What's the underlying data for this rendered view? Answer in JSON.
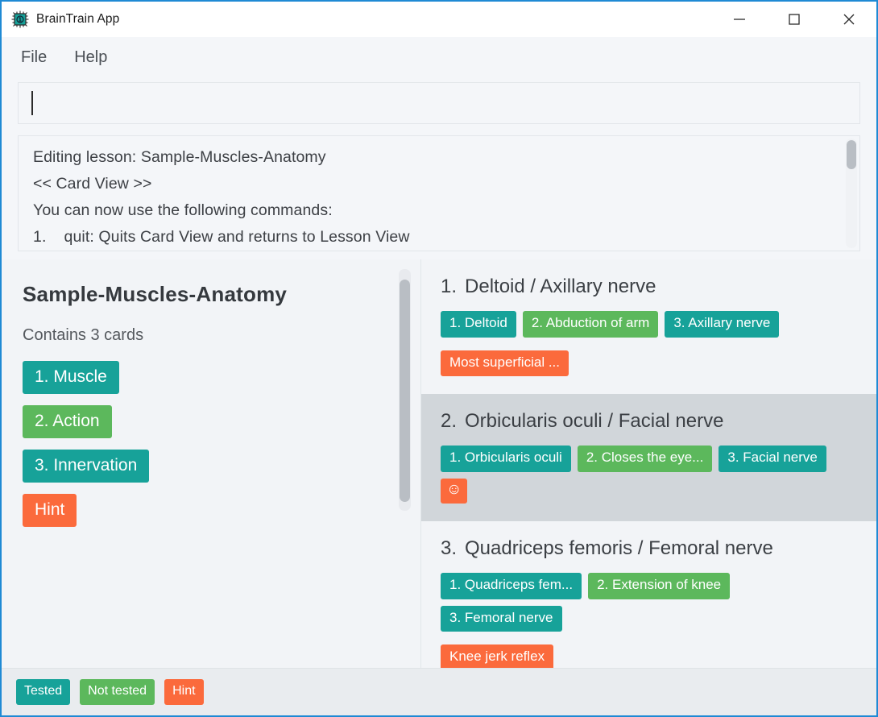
{
  "window": {
    "title": "BrainTrain App",
    "app_icon": "microchip-icon",
    "minimize_label": "Minimize",
    "maximize_label": "Maximize",
    "close_label": "Close"
  },
  "menubar": {
    "items": [
      {
        "label": "File"
      },
      {
        "label": "Help"
      }
    ]
  },
  "command_input": {
    "value": "",
    "placeholder": ""
  },
  "console": {
    "lines": [
      "Editing lesson: Sample-Muscles-Anatomy",
      "<< Card View >>",
      "You can now use the following commands:",
      "1.    quit: Quits Card View and returns to Lesson View"
    ]
  },
  "lesson_panel": {
    "title": "Sample-Muscles-Anatomy",
    "card_count_text": "Contains 3 cards",
    "fields": [
      {
        "label": "1. Muscle",
        "state": "tested"
      },
      {
        "label": "2. Action",
        "state": "not-tested"
      },
      {
        "label": "3. Innervation",
        "state": "tested"
      },
      {
        "label": "Hint",
        "state": "hint"
      }
    ]
  },
  "cards": [
    {
      "index": "1.",
      "title": "Deltoid / Axillary nerve",
      "selected": false,
      "chips": [
        {
          "label": "1. Deltoid",
          "state": "tested",
          "icon": false
        },
        {
          "label": "2. Abduction of arm",
          "state": "not-tested",
          "icon": false
        },
        {
          "label": "3. Axillary nerve",
          "state": "tested",
          "icon": false
        },
        {
          "label": "Most superficial ...",
          "state": "hint",
          "icon": false
        }
      ]
    },
    {
      "index": "2.",
      "title": "Orbicularis oculi / Facial nerve",
      "selected": true,
      "chips": [
        {
          "label": "1. Orbicularis oculi",
          "state": "tested",
          "icon": false
        },
        {
          "label": "2. Closes the eye...",
          "state": "not-tested",
          "icon": false
        },
        {
          "label": "3. Facial nerve",
          "state": "tested",
          "icon": false
        },
        {
          "label": "☺",
          "state": "hint",
          "icon": true,
          "icon_name": "smiley-face-icon"
        }
      ]
    },
    {
      "index": "3.",
      "title": "Quadriceps femoris / Femoral nerve",
      "selected": false,
      "chips": [
        {
          "label": "1. Quadriceps fem...",
          "state": "tested",
          "icon": false
        },
        {
          "label": "2. Extension of knee",
          "state": "not-tested",
          "icon": false
        },
        {
          "label": "3. Femoral nerve",
          "state": "tested",
          "icon": false
        },
        {
          "label": "Knee jerk reflex",
          "state": "hint",
          "icon": false
        }
      ]
    }
  ],
  "legend": {
    "items": [
      {
        "label": "Tested",
        "state": "tested"
      },
      {
        "label": "Not tested",
        "state": "not-tested"
      },
      {
        "label": "Hint",
        "state": "hint"
      }
    ]
  },
  "colors": {
    "tested": "#17a299",
    "not_tested": "#5cb85c",
    "hint": "#fb6a3c",
    "window_border": "#1f8ad4",
    "panel_bg": "#f2f4f7",
    "selected_card_bg": "#d1d6da",
    "statusbar_bg": "#e9ecef"
  }
}
